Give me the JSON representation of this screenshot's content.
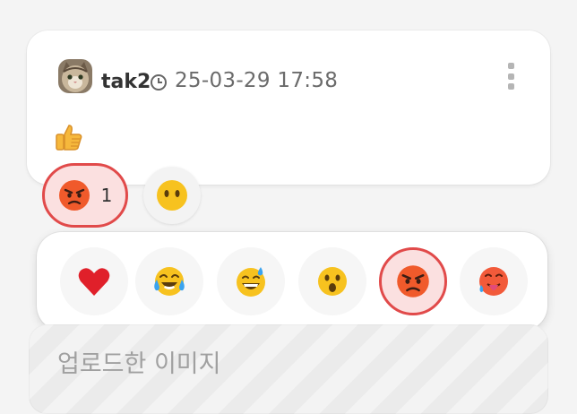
{
  "post": {
    "username": "tak2",
    "timestamp": "25-03-29 17:58",
    "body_emoji": "thumbs-up",
    "menu_icon": "kebab-menu-icon"
  },
  "reactions": {
    "active": {
      "emoji": "pouting-face",
      "count": "1"
    },
    "add_button_icon": "face-without-mouth"
  },
  "emoji_picker": {
    "items": [
      {
        "name": "red-heart",
        "selected": false
      },
      {
        "name": "face-with-tears-of-joy",
        "selected": false
      },
      {
        "name": "grinning-face-with-sweat",
        "selected": false
      },
      {
        "name": "face-with-open-mouth",
        "selected": false
      },
      {
        "name": "pouting-face",
        "selected": true
      },
      {
        "name": "hot-face",
        "selected": false
      }
    ]
  },
  "upload": {
    "label": "업로드한 이미지"
  },
  "colors": {
    "accent": "#e14a4a",
    "accent_bg": "#fbe0e0",
    "background": "#f4f4f4"
  }
}
